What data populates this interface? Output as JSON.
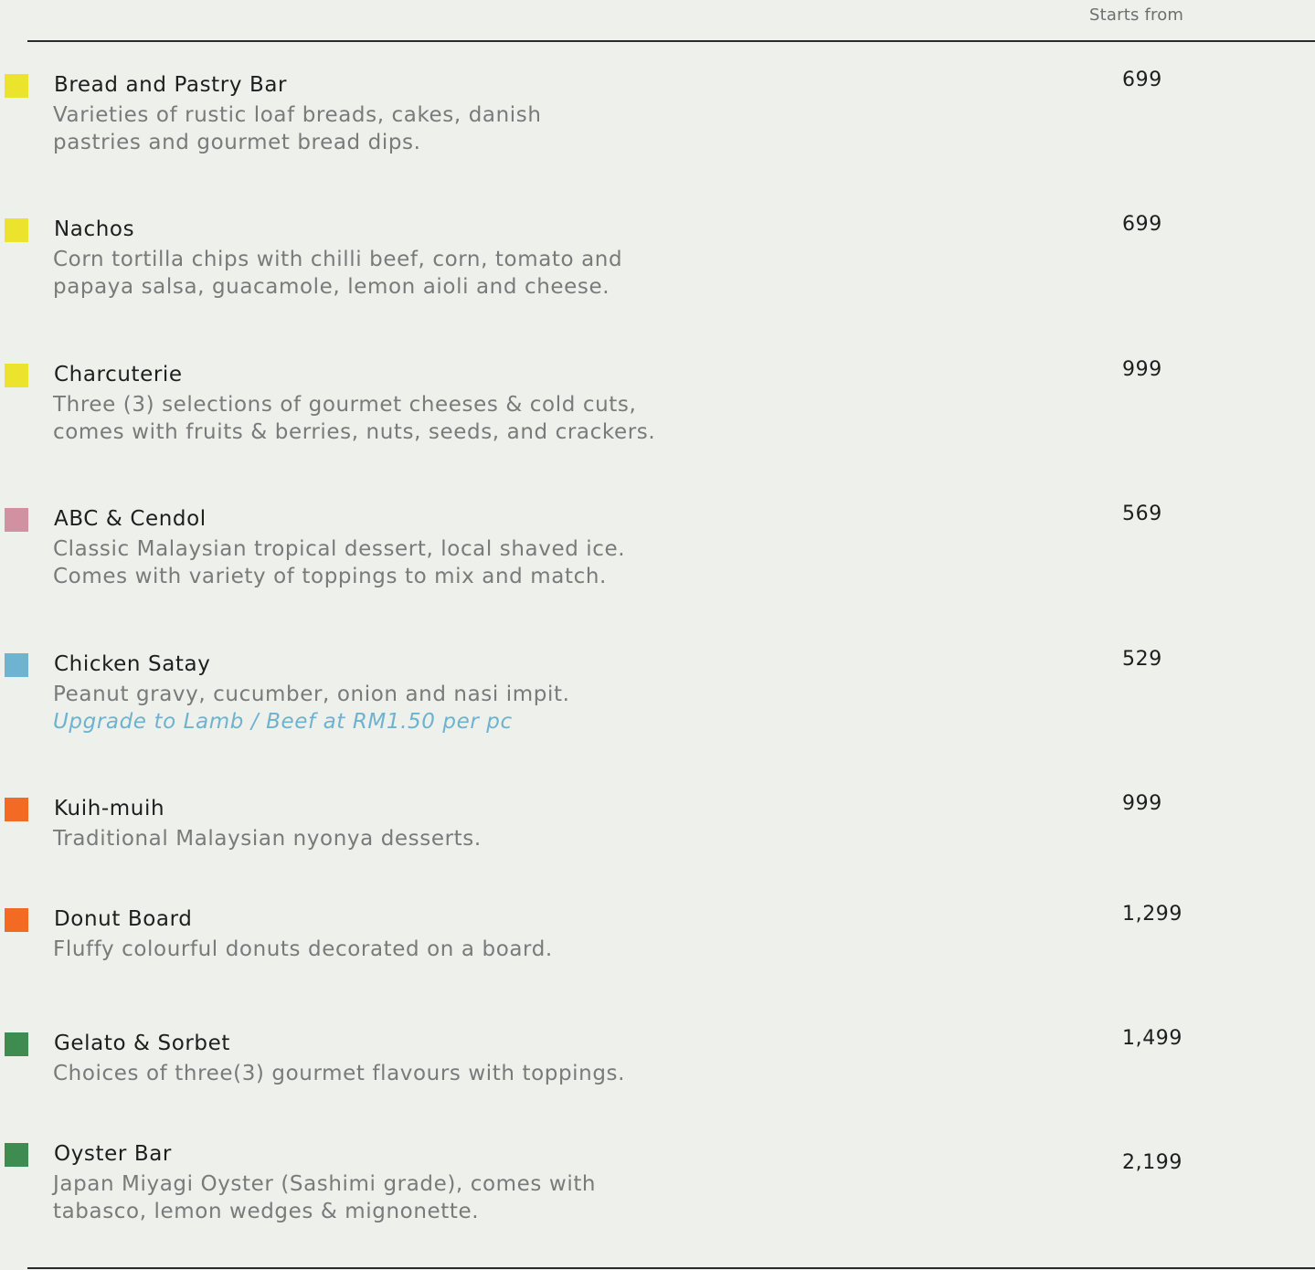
{
  "header": {
    "price_column_label": "Starts from"
  },
  "colors": {
    "yellow": "#ece42c",
    "pink": "#d191a0",
    "blue": "#6eb3d0",
    "orange": "#f26a23",
    "green": "#3e8c50"
  },
  "items": [
    {
      "name": "Bread and Pastry Bar",
      "lines": [
        "Varieties of rustic loaf breads, cakes, danish",
        "pastries and gourmet bread dips."
      ],
      "price": "699",
      "swatch": "#ece42c"
    },
    {
      "name": "Nachos",
      "lines": [
        "Corn tortilla chips with chilli beef, corn, tomato and",
        "papaya salsa, guacamole, lemon aioli and cheese."
      ],
      "price": "699",
      "swatch": "#ece42c"
    },
    {
      "name": "Charcuterie",
      "lines": [
        "Three (3) selections of gourmet cheeses &  cold cuts,",
        "comes with fruits & berries, nuts, seeds, and crackers."
      ],
      "price": "999",
      "swatch": "#ece42c"
    },
    {
      "name": "ABC & Cendol",
      "lines": [
        "Classic Malaysian tropical dessert, local shaved ice.",
        "Comes with variety of toppings to mix and match."
      ],
      "price": "569",
      "swatch": "#d191a0"
    },
    {
      "name": "Chicken Satay",
      "lines": [
        "Peanut gravy, cucumber, onion and nasi impit."
      ],
      "note": "Upgrade to Lamb / Beef at RM1.50 per pc",
      "price": "529",
      "swatch": "#6eb3d0"
    },
    {
      "name": "Kuih-muih",
      "lines": [
        "Traditional Malaysian nyonya desserts."
      ],
      "price": "999",
      "swatch": "#f26a23"
    },
    {
      "name": "Donut Board",
      "lines": [
        "Fluffy colourful donuts decorated on a board."
      ],
      "price": "1,299",
      "swatch": "#f26a23"
    },
    {
      "name": "Gelato & Sorbet",
      "lines": [
        "Choices of three(3) gourmet flavours with toppings."
      ],
      "price": "1,499",
      "swatch": "#3e8c50"
    },
    {
      "name": "Oyster Bar",
      "lines": [
        "Japan Miyagi Oyster (Sashimi grade), comes with",
        "tabasco, lemon wedges & mignonette."
      ],
      "price": "2,199",
      "swatch": "#3e8c50"
    }
  ]
}
